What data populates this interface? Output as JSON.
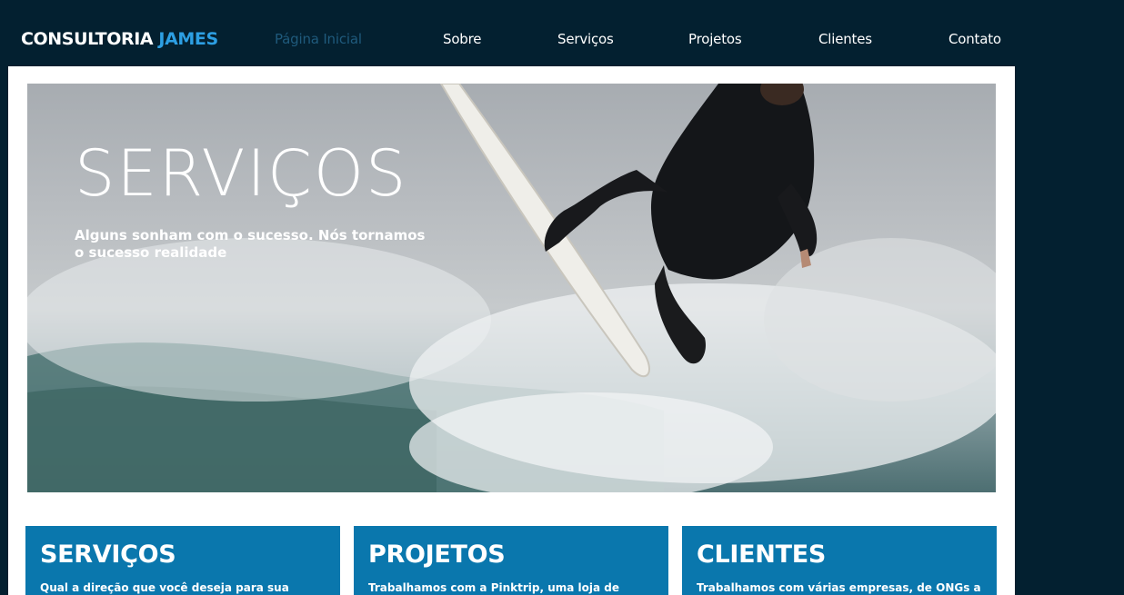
{
  "nav": {
    "logo_main": "CONSULTORIA",
    "logo_accent": "JAMES",
    "links": [
      {
        "label": "Página Inicial",
        "active": true
      },
      {
        "label": "Sobre"
      },
      {
        "label": "Serviços"
      },
      {
        "label": "Projetos"
      },
      {
        "label": "Clientes"
      },
      {
        "label": "Contato"
      }
    ]
  },
  "hero": {
    "title": "SERVIÇOS",
    "subtitle": "Alguns sonham com o sucesso. Nós tornamos o sucesso realidade"
  },
  "cards": [
    {
      "title": "SERVIÇOS",
      "text": "Qual a direção que você deseja para sua empresa?"
    },
    {
      "title": "PROJETOS",
      "text": "Trabalhamos com a Pinktrip, uma loja de roupas"
    },
    {
      "title": "CLIENTES",
      "text": "Trabalhamos com várias empresas, de ONGs a"
    }
  ],
  "colors": {
    "background": "#032030",
    "accent": "#2d9fe3",
    "card": "#0a77ad",
    "active_link": "#1f5a7c"
  }
}
